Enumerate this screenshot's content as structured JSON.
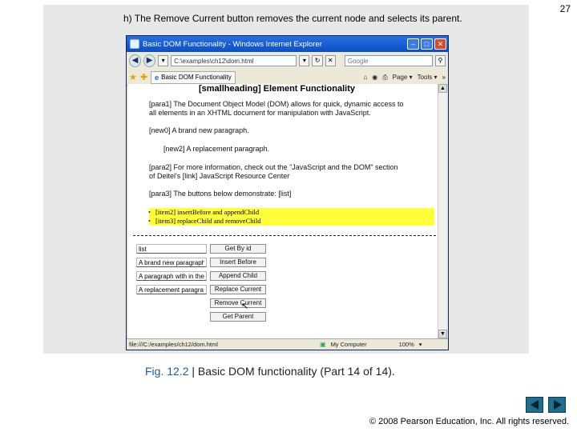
{
  "slide_number": "27",
  "panel_caption": "h) The Remove Current button removes the current node and selects its parent.",
  "browser": {
    "title": "Basic DOM Functionality - Windows Internet Explorer",
    "address": "C:\\examples\\ch12\\dom.html",
    "search_placeholder": "Google",
    "tab_label": "Basic DOM Functionality",
    "tools": {
      "page": "Page",
      "tools": "Tools"
    },
    "status_url": "file:///C:/examples/ch12/dom.html",
    "zone": "My Computer",
    "zoom": "100%"
  },
  "page": {
    "heading": "[smallheading] Element Functionality",
    "para1": [
      "[para1] The Document Object Model (DOM) allows for quick, dynamic access to",
      "all elements in an XHTML document for manipulation with JavaScript."
    ],
    "new0": "[new0] A brand new paragraph.",
    "new2": "[new2] A replacement paragraph.",
    "para2": [
      "[para2] For more information, check out the \"JavaScript and the DOM\" section",
      "of Deitel's [link] JavaScript Resource Center"
    ],
    "para3": "[para3] The buttons below demonstrate: [list]",
    "list_items": [
      "[item2] insertBefore and appendChild",
      "[item3] replaceChild and removeChild"
    ]
  },
  "controls": [
    {
      "input": "list",
      "button": "Get By id"
    },
    {
      "input": "A brand new paragraph",
      "button": "Insert Before"
    },
    {
      "input": "A paragraph with in the b",
      "button": "Append Child"
    },
    {
      "input": "A replacement paragra",
      "button": "Replace Current"
    },
    {
      "input": "",
      "button": "Remove Current"
    },
    {
      "input": "",
      "button": "Get Parent"
    }
  ],
  "figure_caption": {
    "label": "Fig. 12.2",
    "separator": " | ",
    "text": "Basic DOM functionality (Part 14 of 14)."
  },
  "copyright": "© 2008 Pearson Education, Inc.  All rights reserved."
}
